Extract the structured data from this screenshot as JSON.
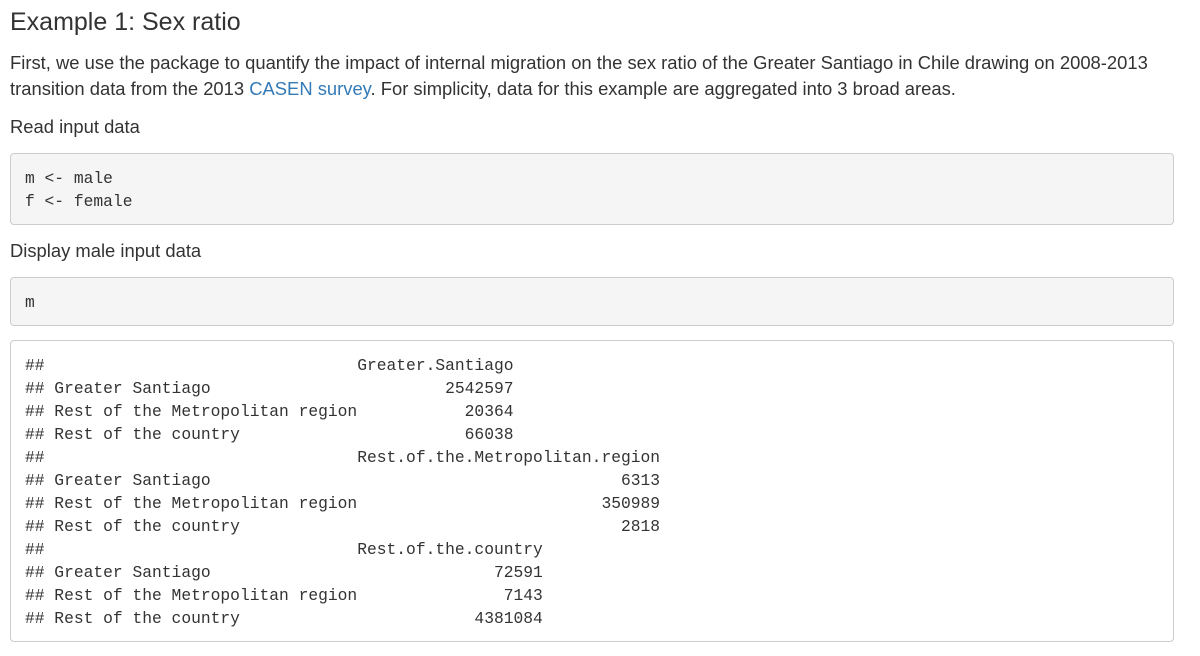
{
  "heading": "Example 1: Sex ratio",
  "intro": {
    "before_link": "First, we use the package to quantify the impact of internal migration on the sex ratio of the Greater Santiago in Chile drawing on 2008-2013 transition data from the 2013 ",
    "link_text": "CASEN survey",
    "after_link": ". For simplicity, data for this example are aggregated into 3 broad areas."
  },
  "label_read": "Read input data",
  "code_read": "m <- male\nf <- female",
  "label_display": "Display male input data",
  "code_display": "m",
  "output": "##                                Greater.Santiago\n## Greater Santiago                        2542597\n## Rest of the Metropolitan region           20364\n## Rest of the country                       66038\n##                                Rest.of.the.Metropolitan.region\n## Greater Santiago                                          6313\n## Rest of the Metropolitan region                         350989\n## Rest of the country                                       2818\n##                                Rest.of.the.country\n## Greater Santiago                             72591\n## Rest of the Metropolitan region               7143\n## Rest of the country                        4381084"
}
